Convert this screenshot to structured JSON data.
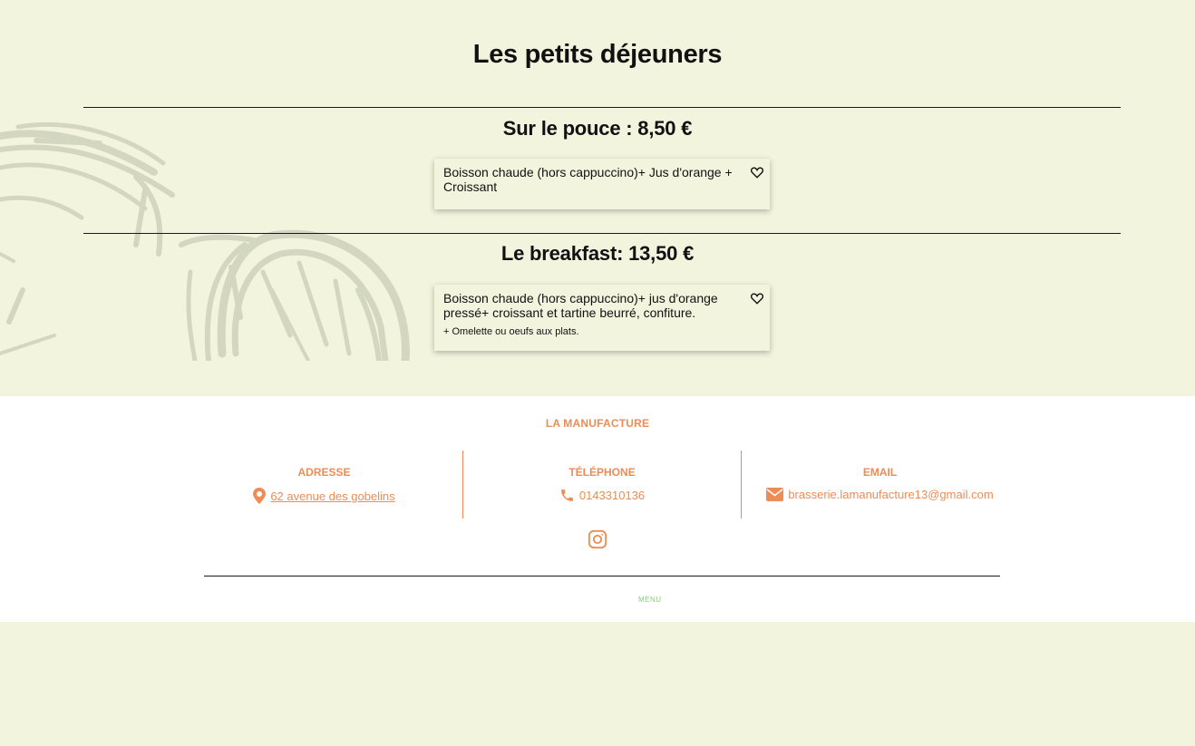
{
  "page": {
    "title": "Les petits déjeuners",
    "background_color": "#f3f4de"
  },
  "sections": [
    {
      "title": "Sur le pouce : 8,50 €",
      "items": [
        {
          "description": "Boisson chaude (hors cappuccino)+ Jus d'orange + Croissant",
          "extra": ""
        }
      ]
    },
    {
      "title": "Le breakfast: 13,50 €",
      "items": [
        {
          "description": "Boisson chaude (hors cappuccino)+ jus d'orange pressé+ croissant et tartine beurré, confiture.",
          "extra": "+ Omelette ou oeufs aux plats."
        }
      ]
    }
  ],
  "footer": {
    "brand": "LA MANUFACTURE",
    "accent_color": "#ee8c55",
    "address": {
      "heading": "ADRESSE",
      "value": "62 avenue des gobelins",
      "icon": "map-pin-icon"
    },
    "phone": {
      "heading": "TÉLÉPHONE",
      "value": "0143310136",
      "icon": "phone-icon"
    },
    "email": {
      "heading": "EMAIL",
      "value": "brasserie.lamanufacture13@gmail.com",
      "icon": "envelope-icon"
    },
    "social_icon": "instagram-icon",
    "menu_link": "MENU",
    "menu_link_color": "#7ed36f"
  }
}
